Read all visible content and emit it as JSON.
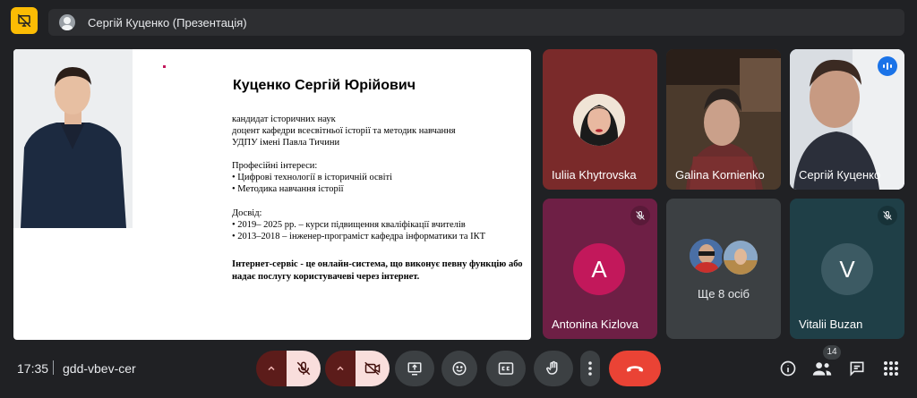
{
  "header": {
    "presenter_label": "Сергій Куценко (Презентація)"
  },
  "slide": {
    "title": "Куценко Сергій Юрійович",
    "lines": [
      "кандидат історичних наук",
      "доцент кафедри всесвітньої історії та методик навчання",
      "УДПУ імені Павла Тичини"
    ],
    "interests_heading": "Професійні інтереси:",
    "interests": [
      "• Цифрові технології в історичній освіті",
      "• Методика навчання історії"
    ],
    "experience_heading": "Досвід:",
    "experience": [
      "• 2019– 2025 рр. – курси підвищення кваліфікації вчителів",
      "• 2013–2018 –  інженер-програміст кафедра інформатики та ІКТ"
    ],
    "definition": "Інтернет-сервіс - це онлайн-система, що виконує певну функцію або надає послугу користувачеві через інтернет."
  },
  "participants": [
    {
      "name": "Iuliia Khytrovska",
      "kind": "photo",
      "bg": "#7a2a2a",
      "muted": false
    },
    {
      "name": "Galina Kornienko",
      "kind": "video",
      "bg": "#3a2b22",
      "muted": false
    },
    {
      "name": "Сергій Куценко",
      "kind": "video",
      "bg": "#5d4c48",
      "muted": false,
      "speaking": true
    },
    {
      "name": "Antonina Kizlova",
      "kind": "letter",
      "letter": "A",
      "bg": "#6e1f45",
      "avatar_bg": "#c2185b",
      "muted": true
    },
    {
      "name": "Ще 8 осіб",
      "kind": "group",
      "bg": "#3c4043"
    },
    {
      "name": "Vitalii Buzan",
      "kind": "letter",
      "letter": "V",
      "bg": "#1f3f47",
      "avatar_bg": "#3c5a63",
      "muted": true
    }
  ],
  "footer": {
    "time": "17:35",
    "meeting_code": "gdd-vbev-cer",
    "people_count": "14"
  },
  "colors": {
    "accent_yellow": "#fbbc04",
    "end_call_red": "#ea4335",
    "muted_pink": "#f9dedc"
  }
}
